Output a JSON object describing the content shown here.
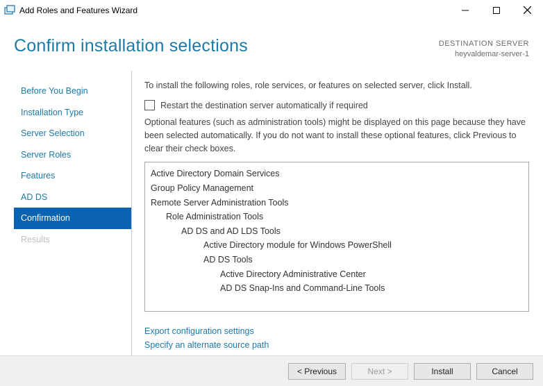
{
  "window": {
    "title": "Add Roles and Features Wizard"
  },
  "header": {
    "title": "Confirm installation selections",
    "dest_label": "DESTINATION SERVER",
    "dest_server": "heyvaldemar-server-1"
  },
  "sidebar": {
    "items": [
      {
        "label": "Before You Begin",
        "selected": false,
        "disabled": false
      },
      {
        "label": "Installation Type",
        "selected": false,
        "disabled": false
      },
      {
        "label": "Server Selection",
        "selected": false,
        "disabled": false
      },
      {
        "label": "Server Roles",
        "selected": false,
        "disabled": false
      },
      {
        "label": "Features",
        "selected": false,
        "disabled": false
      },
      {
        "label": "AD DS",
        "selected": false,
        "disabled": false
      },
      {
        "label": "Confirmation",
        "selected": true,
        "disabled": false
      },
      {
        "label": "Results",
        "selected": false,
        "disabled": true
      }
    ]
  },
  "main": {
    "intro": "To install the following roles, role services, or features on selected server, click Install.",
    "restart_label": "Restart the destination server automatically if required",
    "restart_checked": false,
    "note": "Optional features (such as administration tools) might be displayed on this page because they have been selected automatically. If you do not want to install these optional features, click Previous to clear their check boxes.",
    "selections": [
      {
        "text": "Active Directory Domain Services",
        "indent": 0
      },
      {
        "text": "Group Policy Management",
        "indent": 0
      },
      {
        "text": "Remote Server Administration Tools",
        "indent": 0
      },
      {
        "text": "Role Administration Tools",
        "indent": 1
      },
      {
        "text": "AD DS and AD LDS Tools",
        "indent": 2
      },
      {
        "text": "Active Directory module for Windows PowerShell",
        "indent": 3
      },
      {
        "text": "AD DS Tools",
        "indent": 3
      },
      {
        "text": "Active Directory Administrative Center",
        "indent": 4
      },
      {
        "text": "AD DS Snap-Ins and Command-Line Tools",
        "indent": 4
      }
    ],
    "links": {
      "export": "Export configuration settings",
      "altpath": "Specify an alternate source path"
    }
  },
  "footer": {
    "previous": "< Previous",
    "next": "Next >",
    "install": "Install",
    "cancel": "Cancel"
  }
}
